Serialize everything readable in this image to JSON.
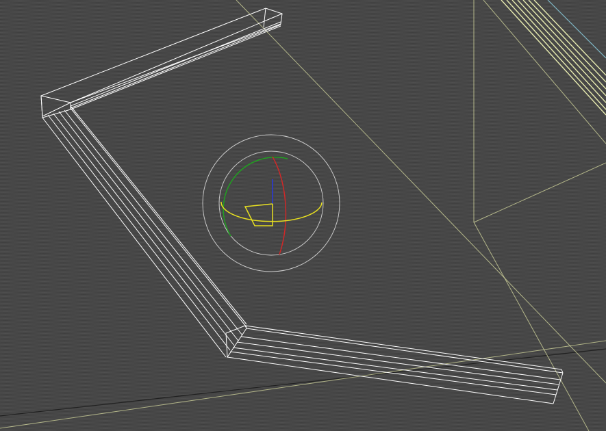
{
  "viewport": {
    "view_style": "wireframe",
    "colors": {
      "background": "#4f4f4f",
      "scanline": "#3f3f3f",
      "wire": "#ffffff",
      "guide": "#d8dca0",
      "guide_bright": "#e8ecb0",
      "guide_cyan": "#7fb7c6",
      "horizon": "#202020",
      "gizmo_circle": "#c8c8c8",
      "gizmo_x": "#d02828",
      "gizmo_y": "#20a020",
      "gizmo_z": "#2838e0",
      "gizmo_ring": "#e8e020"
    }
  },
  "objects": [
    {
      "name": "selected-wire-mesh",
      "type": "extruded-frame",
      "segments": 3,
      "selected": true
    }
  ],
  "gizmo": {
    "type": "rotate",
    "axes": [
      "x",
      "y",
      "z"
    ]
  }
}
